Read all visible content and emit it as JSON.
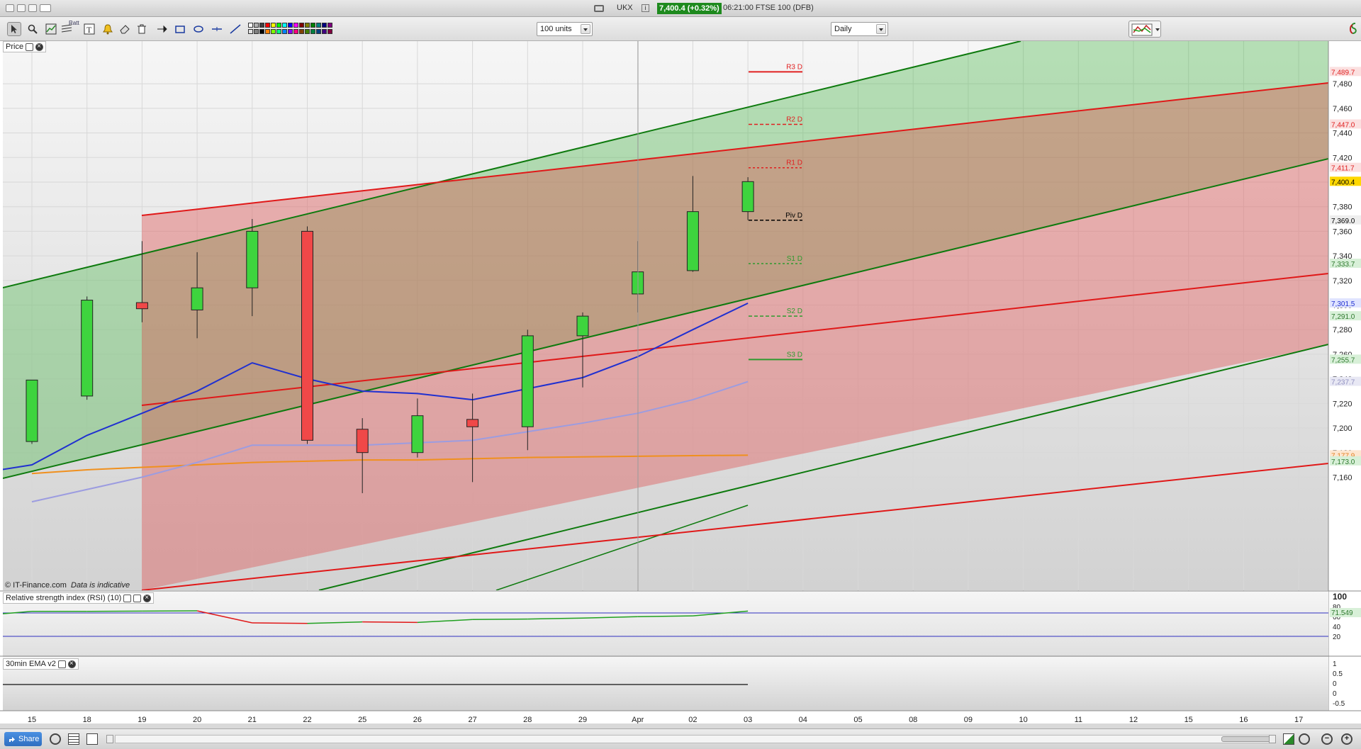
{
  "titlebar": {
    "symbol": "UKX",
    "quote": "7,400.4 (+0.32%)",
    "time_desc": "06:21:00 FTSE 100 (DFB)"
  },
  "toolbar": {
    "units_select": "100 units",
    "interval_select": "Daily",
    "draw_tool_labels": [
      "Ratt"
    ],
    "palette": [
      "#ffffff",
      "#e0e0e0",
      "#b0b0b0",
      "#808080",
      "#404040",
      "#000000",
      "#ff0000",
      "#ff8000",
      "#ffff00",
      "#80ff00",
      "#00ff00",
      "#00ff80",
      "#00ffff",
      "#0080ff",
      "#0000ff",
      "#8000ff",
      "#ff00ff",
      "#ff0080",
      "#800000",
      "#804000",
      "#808000",
      "#408000",
      "#008000",
      "#008040",
      "#008080",
      "#004080",
      "#000080",
      "#400080",
      "#800080",
      "#800040"
    ]
  },
  "price_panel": {
    "label": "Price",
    "watermark": "© IT-Finance.com",
    "watermark_note": "Data is indicative"
  },
  "rsi_panel": {
    "label": "Relative strength index (RSI) (10)",
    "value_tag": "71.549",
    "axis_labels": [
      "100",
      "80",
      "60",
      "40",
      "20"
    ],
    "values": [
      66,
      71,
      71,
      71.5,
      72,
      47,
      46,
      49,
      48,
      54,
      55,
      57,
      60,
      61.5,
      71.5
    ]
  },
  "ema_panel": {
    "label": "30min EMA v2",
    "axis_labels": [
      "1",
      "0.5",
      "0",
      "0",
      "-0.5"
    ]
  },
  "pivots": [
    {
      "label": "R3 D",
      "value": 7489.7,
      "color": "#e02020",
      "style": "solid"
    },
    {
      "label": "R2 D",
      "value": 7447.0,
      "color": "#e02020",
      "style": "dash"
    },
    {
      "label": "R1 D",
      "value": 7411.7,
      "color": "#e02020",
      "style": "dot"
    },
    {
      "label": "Piv D",
      "value": 7369.0,
      "color": "#000000",
      "style": "dash"
    },
    {
      "label": "S1 D",
      "value": 7333.7,
      "color": "#2e9a2e",
      "style": "dot"
    },
    {
      "label": "S2 D",
      "value": 7291.0,
      "color": "#2e9a2e",
      "style": "dash"
    },
    {
      "label": "S3 D",
      "value": 7255.7,
      "color": "#2e9a2e",
      "style": "solid"
    }
  ],
  "price_tags": [
    {
      "text": "7,489.7",
      "value": 7489.7,
      "bg": "#fbe0e0",
      "fg": "#e02020"
    },
    {
      "text": "7,447.0",
      "value": 7447.0,
      "bg": "#fbe0e0",
      "fg": "#e02020"
    },
    {
      "text": "7,411.7",
      "value": 7411.7,
      "bg": "#fbe0e0",
      "fg": "#e02020"
    },
    {
      "text": "7,400.4",
      "value": 7400.4,
      "bg": "#ffd800",
      "fg": "#000000"
    },
    {
      "text": "7,369.0",
      "value": 7369.0,
      "bg": "#eeeeee",
      "fg": "#000000"
    },
    {
      "text": "7,333.7",
      "value": 7333.7,
      "bg": "#d8f0d8",
      "fg": "#2e7a2e"
    },
    {
      "text": "7,301.5",
      "value": 7301.5,
      "bg": "#e0e4ff",
      "fg": "#2030d0"
    },
    {
      "text": "7,291.0",
      "value": 7291.0,
      "bg": "#d8f0d8",
      "fg": "#2e7a2e"
    },
    {
      "text": "7,255.7",
      "value": 7255.7,
      "bg": "#d8f0d8",
      "fg": "#2e7a2e"
    },
    {
      "text": "7,237.7",
      "value": 7237.7,
      "bg": "#e8e8f4",
      "fg": "#9090c0"
    },
    {
      "text": "7,177.9",
      "value": 7177.9,
      "bg": "#fde6d0",
      "fg": "#e08020"
    },
    {
      "text": "7,173.0",
      "value": 7173.0,
      "bg": "#d8f0d8",
      "fg": "#2e7a2e"
    }
  ],
  "chart_data": {
    "type": "candlestick",
    "y_axis_ticks": [
      7480,
      7460,
      7440,
      7420,
      7400,
      7380,
      7360,
      7340,
      7320,
      7300,
      7280,
      7260,
      7240,
      7220,
      7200,
      7180,
      7160
    ],
    "ylim": [
      7140,
      7505
    ],
    "x_ticks": [
      "15",
      "18",
      "19",
      "20",
      "21",
      "22",
      "25",
      "26",
      "27",
      "28",
      "29",
      "Apr",
      "02",
      "03",
      "04",
      "05",
      "08",
      "09",
      "10",
      "11",
      "12",
      "15",
      "16",
      "17"
    ],
    "candles": [
      {
        "open": 7189,
        "high": 7233,
        "low": 7187,
        "close": 7239
      },
      {
        "open": 7226,
        "high": 7307,
        "low": 7223,
        "close": 7304
      },
      {
        "open": 7302,
        "high": 7352,
        "low": 7286,
        "close": 7297
      },
      {
        "open": 7296,
        "high": 7343,
        "low": 7273,
        "close": 7314
      },
      {
        "open": 7314,
        "high": 7370,
        "low": 7291,
        "close": 7360
      },
      {
        "open": 7360,
        "high": 7364,
        "low": 7187,
        "close": 7190
      },
      {
        "open": 7199,
        "high": 7208,
        "low": 7147,
        "close": 7180
      },
      {
        "open": 7180,
        "high": 7224,
        "low": 7176,
        "close": 7210
      },
      {
        "open": 7207,
        "high": 7228,
        "low": 7156,
        "close": 7201
      },
      {
        "open": 7201,
        "high": 7280,
        "low": 7182,
        "close": 7275
      },
      {
        "open": 7275,
        "high": 7294,
        "low": 7233,
        "close": 7291
      },
      {
        "open": 7309,
        "high": 7352,
        "low": 7294,
        "close": 7327
      },
      {
        "open": 7328,
        "high": 7405,
        "low": 7327,
        "close": 7376
      },
      {
        "open": 7376,
        "high": 7404,
        "low": 7369,
        "close": 7400.4
      }
    ],
    "ma_fast": [
      7163,
      7170,
      7194,
      7212,
      7230,
      7253,
      7240,
      7230,
      7228,
      7223,
      7232,
      7241,
      7258,
      7280,
      7301.5
    ],
    "ma_mid": [
      7140,
      7150,
      7160,
      7172,
      7186,
      7186,
      7186,
      7188,
      7190,
      7197,
      7204,
      7212,
      7223,
      7237.7
    ],
    "ma_slow": [
      7163,
      7166,
      7168,
      7170,
      7172,
      7173,
      7174,
      7174,
      7175,
      7176,
      7176.5,
      7177,
      7177.5,
      7177.9
    ]
  },
  "bottombar": {
    "share_label": "Share"
  }
}
